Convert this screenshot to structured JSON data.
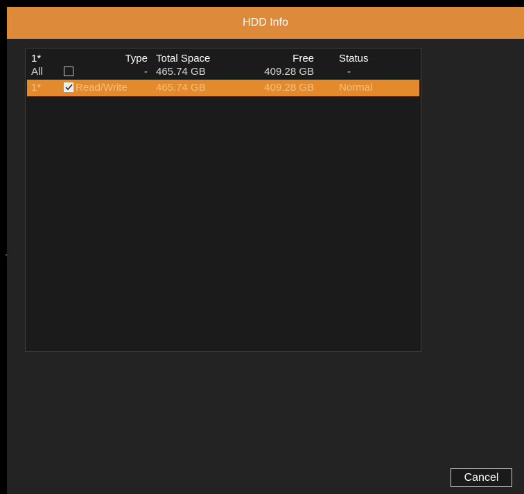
{
  "window": {
    "title": "HDD Info"
  },
  "table": {
    "headers": {
      "id": "1*",
      "type": "Type",
      "total": "Total Space",
      "free": "Free",
      "status": "Status"
    },
    "all_row": {
      "id": "All",
      "checked": false,
      "type": "-",
      "total": "465.74 GB",
      "free": "409.28 GB",
      "status": "-"
    },
    "rows": [
      {
        "id": "1*",
        "checked": true,
        "type": "Read/Write",
        "total": "465.74 GB",
        "free": "409.28 GB",
        "status": "Normal",
        "selected": true
      }
    ]
  },
  "footer": {
    "cancel_label": "Cancel"
  },
  "colors": {
    "accent": "#dd8a3a",
    "selected_row": "#e38a2c",
    "panel": "#1b1b1b",
    "background": "#232323"
  },
  "icons": {
    "checked": "checkmark-icon"
  }
}
